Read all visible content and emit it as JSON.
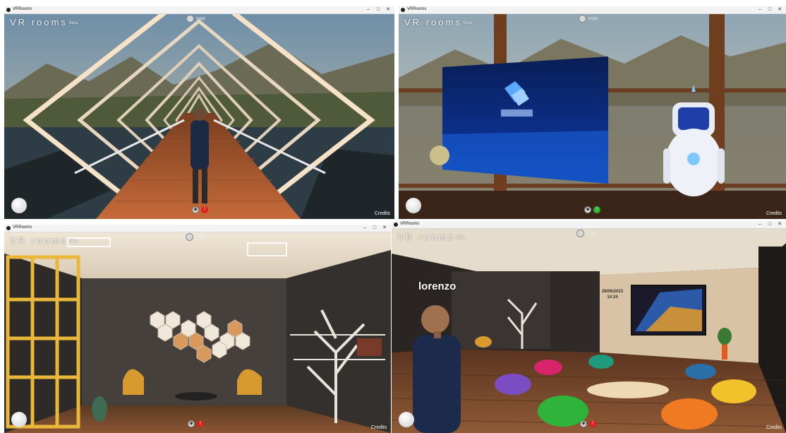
{
  "app": {
    "window_title": "VRRooms",
    "brand": "VR rooms",
    "brand_beta": "Beta",
    "username": "maz",
    "credits_label": "Credits",
    "window_controls": {
      "minimize": "–",
      "maximize": "□",
      "close": "✕"
    }
  },
  "icons": {
    "camera": "camera-icon",
    "microphone": "microphone-icon",
    "joystick": "joystick-icon"
  },
  "colors": {
    "mic_muted": "#e0201a",
    "mic_active": "#2db533"
  },
  "windows": [
    {
      "scene": "bridge",
      "mic_state": "muted",
      "mic_glyph": "!"
    },
    {
      "scene": "screen-robot",
      "mic_state": "active",
      "mic_glyph": "!"
    },
    {
      "scene": "library",
      "mic_state": "muted",
      "mic_glyph": "!"
    },
    {
      "scene": "lounge",
      "mic_state": "muted",
      "mic_glyph": "!",
      "avatar_name": "lorenzo",
      "clock_date": "28/06/2023",
      "clock_time": "14:24"
    }
  ],
  "camera_glyph": "◉"
}
